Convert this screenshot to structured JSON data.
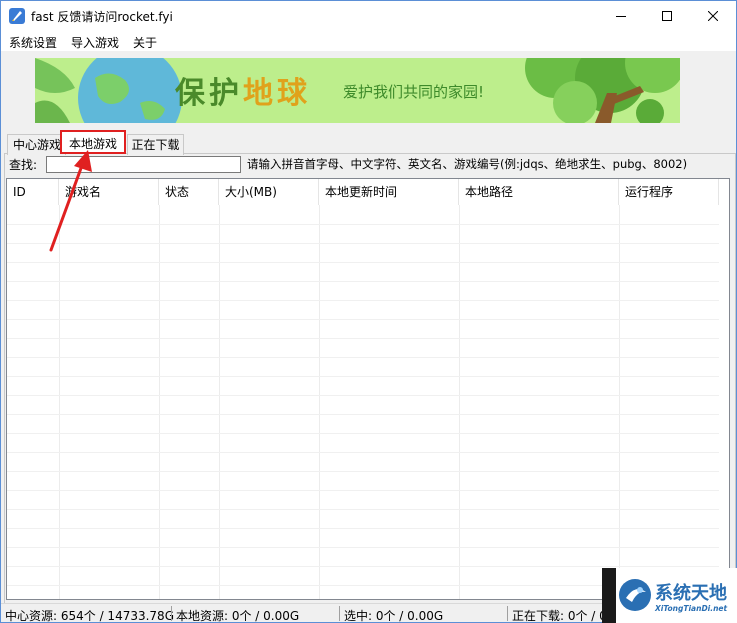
{
  "window": {
    "title": "fast 反馈请访问rocket.fyi",
    "controls": {
      "minimize": "minimize",
      "maximize": "maximize",
      "close": "close"
    }
  },
  "menu": {
    "items": [
      "系统设置",
      "导入游戏",
      "关于"
    ]
  },
  "banner": {
    "title_part1": "保护",
    "title_part2": "地球",
    "subtitle": "爱护我们共同的家园!"
  },
  "tabs": [
    {
      "label": "中心游戏",
      "selected": false
    },
    {
      "label": "本地游戏",
      "selected": true,
      "highlighted": true
    },
    {
      "label": "正在下载",
      "selected": false
    }
  ],
  "search": {
    "label": "查找:",
    "value": "",
    "hint": "请输入拼音首字母、中文字符、英文名、游戏编号(例:jdqs、绝地求生、pubg、8002)"
  },
  "table": {
    "columns": [
      "ID",
      "游戏名",
      "状态",
      "大小(MB)",
      "本地更新时间",
      "本地路径",
      "运行程序"
    ],
    "rows": []
  },
  "status": {
    "center_resources": "中心资源: 654个 / 14733.78G",
    "local_resources": "本地资源: 0个 / 0.00G",
    "selected": "选中: 0个 / 0.00G",
    "downloading": "正在下载: 0个 / 0.00G"
  },
  "watermark": {
    "text_cn": "系统天地",
    "text_en": "XiTongTianDi.net"
  },
  "colors": {
    "highlight": "#e02020",
    "window_border": "#5b8fd6",
    "banner_green": "#4a8a2a",
    "banner_gold": "#e0a21b"
  }
}
